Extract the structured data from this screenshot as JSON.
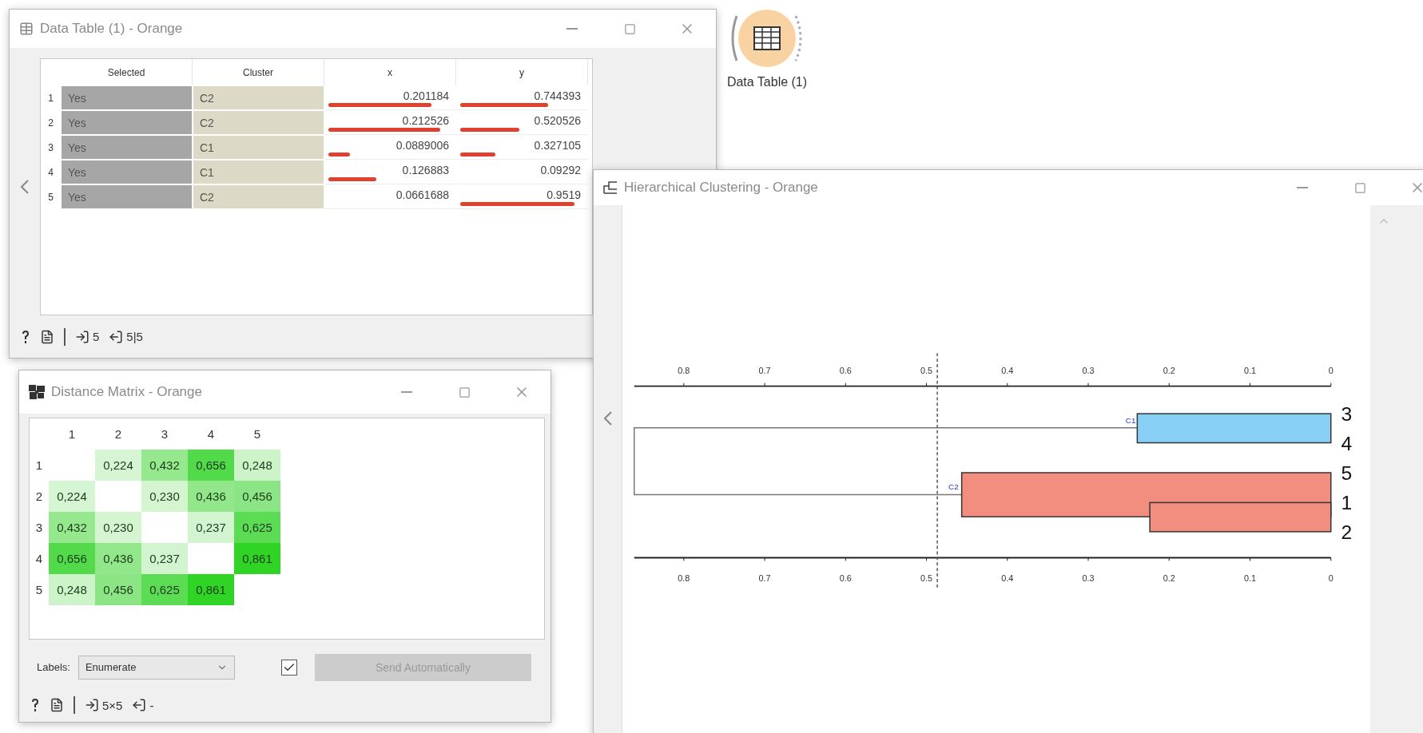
{
  "canvas_node": {
    "label": "Data Table (1)"
  },
  "data_table_window": {
    "title": "Data Table (1) - Orange",
    "columns": [
      {
        "name": "Selected",
        "kind": "meta",
        "color": "#a6a6a6"
      },
      {
        "name": "Cluster",
        "kind": "meta",
        "color": "#dcdac6"
      },
      {
        "name": "x",
        "kind": "numeric"
      },
      {
        "name": "y",
        "kind": "numeric"
      }
    ],
    "rows": [
      {
        "index": "1",
        "cells": [
          {
            "text": "Yes"
          },
          {
            "text": "C2"
          },
          {
            "text": "0.201184",
            "level": 0.86
          },
          {
            "text": "0.744393",
            "level": 0.73
          }
        ]
      },
      {
        "index": "2",
        "cells": [
          {
            "text": "Yes"
          },
          {
            "text": "C2"
          },
          {
            "text": "0.212526",
            "level": 0.93
          },
          {
            "text": "0.520526",
            "level": 0.49
          }
        ]
      },
      {
        "index": "3",
        "cells": [
          {
            "text": "Yes"
          },
          {
            "text": "C1"
          },
          {
            "text": "0.0889006",
            "level": 0.18
          },
          {
            "text": "0.327105",
            "level": 0.29
          }
        ]
      },
      {
        "index": "4",
        "cells": [
          {
            "text": "Yes"
          },
          {
            "text": "C1"
          },
          {
            "text": "0.126883",
            "level": 0.4
          },
          {
            "text": "0.09292"
          }
        ]
      },
      {
        "index": "5",
        "cells": [
          {
            "text": "Yes"
          },
          {
            "text": "C2"
          },
          {
            "text": "0.0661688"
          },
          {
            "text": "0.9519",
            "level": 0.95
          }
        ]
      }
    ],
    "status": {
      "input": "5",
      "output": "5|5"
    }
  },
  "distance_window": {
    "title": "Distance Matrix - Orange",
    "column_headers": [
      "1",
      "2",
      "3",
      "4",
      "5"
    ],
    "rows": [
      {
        "label": "1",
        "cells": [
          null,
          {
            "text": "0,224",
            "color": "#d6f5d3"
          },
          {
            "text": "0,432",
            "color": "#95e88d"
          },
          {
            "text": "0,656",
            "color": "#52da4a"
          },
          {
            "text": "0,248",
            "color": "#cdf3c9"
          }
        ]
      },
      {
        "label": "2",
        "cells": [
          {
            "text": "0,224",
            "color": "#d6f5d3"
          },
          null,
          {
            "text": "0,230",
            "color": "#d4f5d0"
          },
          {
            "text": "0,436",
            "color": "#93e78b"
          },
          {
            "text": "0,456",
            "color": "#8be584"
          }
        ]
      },
      {
        "label": "3",
        "cells": [
          {
            "text": "0,432",
            "color": "#95e88d"
          },
          {
            "text": "0,230",
            "color": "#d4f5d0"
          },
          null,
          {
            "text": "0,237",
            "color": "#d2f4ce"
          },
          {
            "text": "0,625",
            "color": "#5cdc54"
          }
        ]
      },
      {
        "label": "4",
        "cells": [
          {
            "text": "0,656",
            "color": "#52da4a"
          },
          {
            "text": "0,436",
            "color": "#93e78b"
          },
          {
            "text": "0,237",
            "color": "#d2f4ce"
          },
          null,
          {
            "text": "0,861",
            "color": "#2fd425"
          }
        ]
      },
      {
        "label": "5",
        "cells": [
          {
            "text": "0,248",
            "color": "#cdf3c9"
          },
          {
            "text": "0,456",
            "color": "#8be584"
          },
          {
            "text": "0,625",
            "color": "#5cdc54"
          },
          {
            "text": "0,861",
            "color": "#2fd425"
          },
          null
        ]
      }
    ],
    "labels_field": {
      "label": "Labels:",
      "value": "Enumerate"
    },
    "auto_send": {
      "checked": true,
      "label": "Send Automatically",
      "disabled": true
    },
    "status": {
      "input": "5×5",
      "output": "-"
    }
  },
  "clustering_window": {
    "title": "Hierarchical Clustering - Orange",
    "axis_top_ticks": [
      "0.8",
      "0.7",
      "0.6",
      "0.5",
      "0.4",
      "0.3",
      "0.2",
      "0.1",
      "0"
    ],
    "axis_bottom_ticks": [
      "0.8",
      "0.7",
      "0.6",
      "0.5",
      "0.4",
      "0.3",
      "0.2",
      "0.1",
      "0"
    ],
    "clusters": [
      {
        "label": "C1",
        "color": "#87cff5",
        "leaves": [
          "3",
          "4"
        ]
      },
      {
        "label": "C2",
        "color": "#f28e80",
        "leaves": [
          "5",
          "1",
          "2"
        ]
      }
    ]
  }
}
